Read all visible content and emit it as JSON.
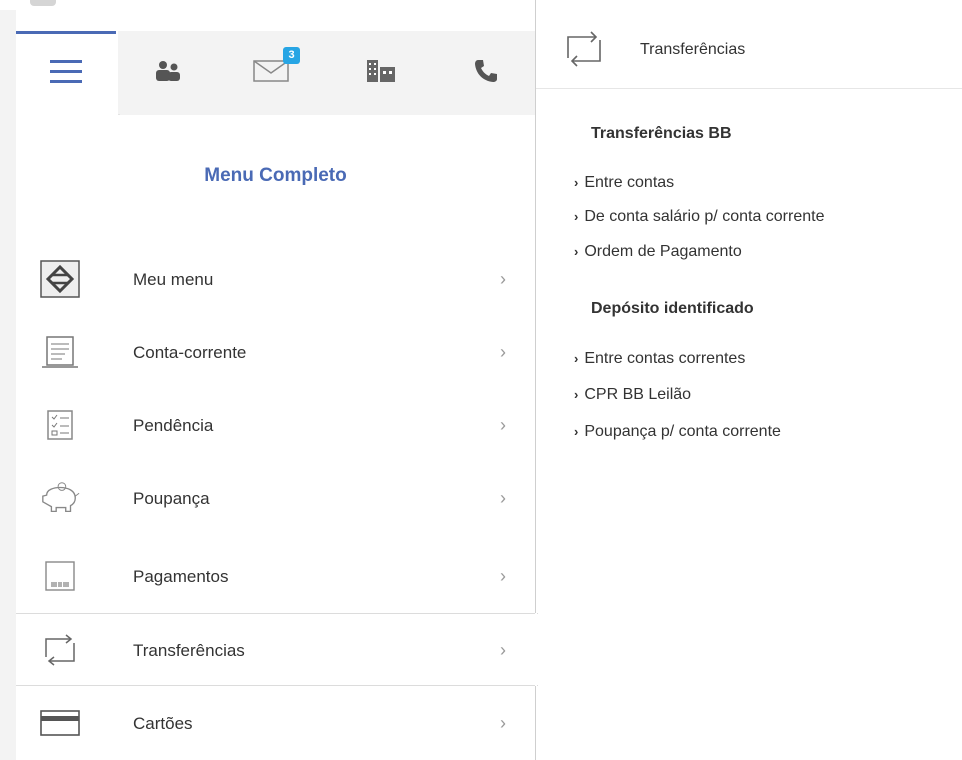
{
  "tabs": [
    {
      "icon": "hamburger-menu-icon",
      "active": true
    },
    {
      "icon": "people-icon"
    },
    {
      "icon": "mail-icon",
      "badge": "3"
    },
    {
      "icon": "building-icon"
    },
    {
      "icon": "phone-icon"
    }
  ],
  "menu": {
    "title": "Menu Completo",
    "chevron": "›",
    "items": [
      {
        "label": "Meu menu",
        "icon": "bb-logo-icon"
      },
      {
        "label": "Conta-corrente",
        "icon": "statement-icon"
      },
      {
        "label": "Pendência",
        "icon": "checklist-icon"
      },
      {
        "label": "Poupança",
        "icon": "piggy-bank-icon"
      },
      {
        "label": "Pagamentos",
        "icon": "barcode-slip-icon"
      },
      {
        "label": "Transferências",
        "icon": "transfer-icon",
        "selected": true
      },
      {
        "label": "Cartões",
        "icon": "card-icon"
      }
    ]
  },
  "detail": {
    "header_title": "Transferências",
    "sections": [
      {
        "title": "Transferências BB",
        "links": [
          "Entre contas",
          "De conta salário p/ conta corrente",
          "Ordem de Pagamento"
        ]
      },
      {
        "title": "Depósito identificado",
        "links": [
          "Entre contas correntes",
          "CPR BB Leilão",
          "Poupança p/ conta corrente"
        ]
      }
    ],
    "link_arrow": "›"
  },
  "colors": {
    "accent": "#4a6ab5",
    "badge": "#27a5e4",
    "icon": "#555555"
  }
}
